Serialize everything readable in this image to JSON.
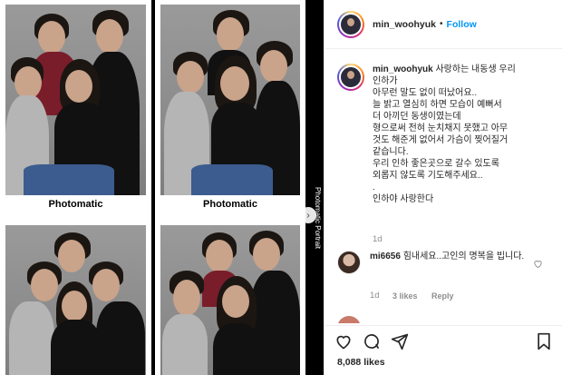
{
  "photo": {
    "caption_left": "Photomatic",
    "caption_right": "Photomatic",
    "side_label": "Photomatic Portrait"
  },
  "header": {
    "username": "min_woohyuk",
    "dot": "•",
    "follow_label": "Follow"
  },
  "post": {
    "username": "min_woohyuk",
    "caption_lines": [
      "사랑하는 내동생 우리",
      "인하가",
      "아무런 말도 없이 떠났어요..",
      "늘 밝고 열심히 하면 모습이 예뻐서",
      "더 아끼던 동생이였는데",
      "형으로써 전혀 눈치채지 못했고 아무",
      "것도 해준게 없어서 가슴이 찢어질거",
      "같습니다.",
      "우리 인하 좋은곳으로 갈수 있도록",
      "외롭지 않도록 기도해주세요..",
      ".",
      "인하야 사랑한다"
    ],
    "time": "1d"
  },
  "comment": {
    "username": "mi6656",
    "text": "힘내세요..고인의 명복을 빕니다.",
    "time": "1d",
    "likes": "3 likes",
    "reply_label": "Reply"
  },
  "footer": {
    "likes_count": "8,088 likes"
  },
  "colors": {
    "follow_blue": "#0095f6",
    "text": "#262626",
    "meta": "#8e8e8e"
  },
  "icons": [
    "heart-icon",
    "comment-icon",
    "share-icon",
    "bookmark-icon",
    "chevron-right-icon"
  ]
}
